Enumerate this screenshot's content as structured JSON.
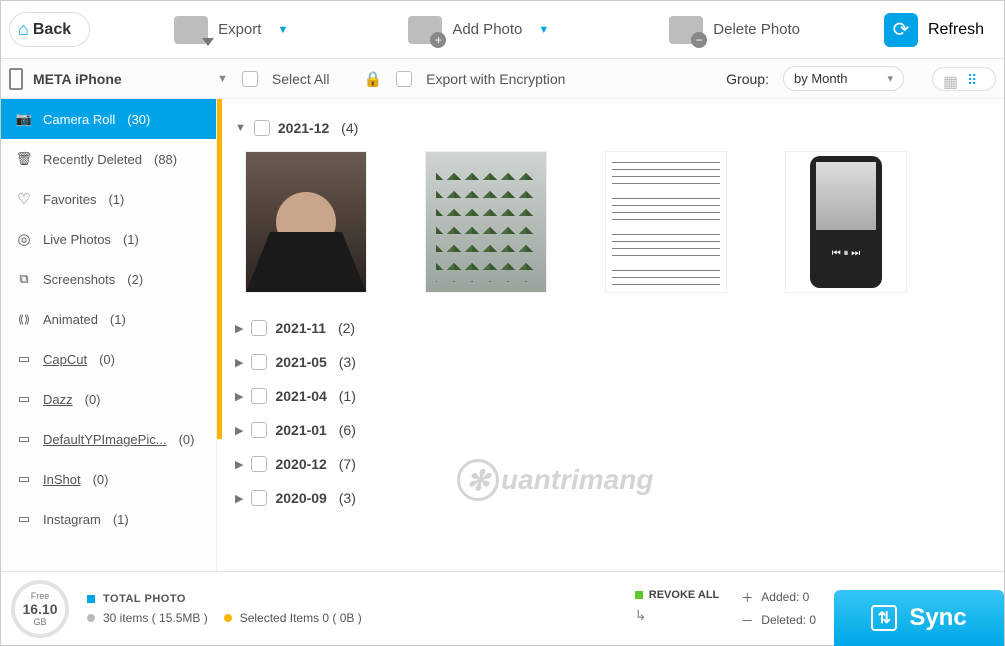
{
  "toolbar": {
    "back": "Back",
    "export": "Export",
    "add_photo": "Add Photo",
    "delete_photo": "Delete Photo",
    "refresh": "Refresh"
  },
  "device": {
    "name": "META iPhone"
  },
  "filter": {
    "select_all": "Select All",
    "export_encryption": "Export with Encryption",
    "group_label": "Group:",
    "group_value": "by Month"
  },
  "sidebar": {
    "items": [
      {
        "label": "Camera Roll",
        "count": "(30)",
        "icon": "camera",
        "active": true
      },
      {
        "label": "Recently Deleted",
        "count": "(88)",
        "icon": "trash"
      },
      {
        "label": "Favorites",
        "count": "(1)",
        "icon": "heart"
      },
      {
        "label": "Live Photos",
        "count": "(1)",
        "icon": "live"
      },
      {
        "label": "Screenshots",
        "count": "(2)",
        "icon": "shot"
      },
      {
        "label": "Animated",
        "count": "(1)",
        "icon": "anim"
      },
      {
        "label": "CapCut",
        "count": "(0)",
        "icon": "album",
        "underline": true
      },
      {
        "label": "Dazz",
        "count": "(0)",
        "icon": "album",
        "underline": true
      },
      {
        "label": "DefaultYPImagePic...",
        "count": "(0)",
        "icon": "album",
        "underline": true
      },
      {
        "label": "InShot",
        "count": "(0)",
        "icon": "album",
        "underline": true
      },
      {
        "label": "Instagram",
        "count": "(1)",
        "icon": "album"
      }
    ]
  },
  "groups": [
    {
      "label": "2021-12",
      "count": "(4)",
      "expanded": true,
      "thumbs": 4
    },
    {
      "label": "2021-11",
      "count": "(2)",
      "expanded": false
    },
    {
      "label": "2021-05",
      "count": "(3)",
      "expanded": false
    },
    {
      "label": "2021-04",
      "count": "(1)",
      "expanded": false
    },
    {
      "label": "2021-01",
      "count": "(6)",
      "expanded": false
    },
    {
      "label": "2020-12",
      "count": "(7)",
      "expanded": false
    },
    {
      "label": "2020-09",
      "count": "(3)",
      "expanded": false
    }
  ],
  "watermark": "uantrimang",
  "bottom": {
    "storage_free_label": "Free",
    "storage_value": "16.10",
    "storage_unit": "GB",
    "total_photo_label": "TOTAL PHOTO",
    "total_line": "30 items ( 15.5MB )",
    "selected_line": "Selected Items 0 ( 0B )",
    "revoke_label": "REVOKE ALL",
    "added_label": "Added: 0",
    "deleted_label": "Deleted: 0",
    "sync": "Sync"
  }
}
